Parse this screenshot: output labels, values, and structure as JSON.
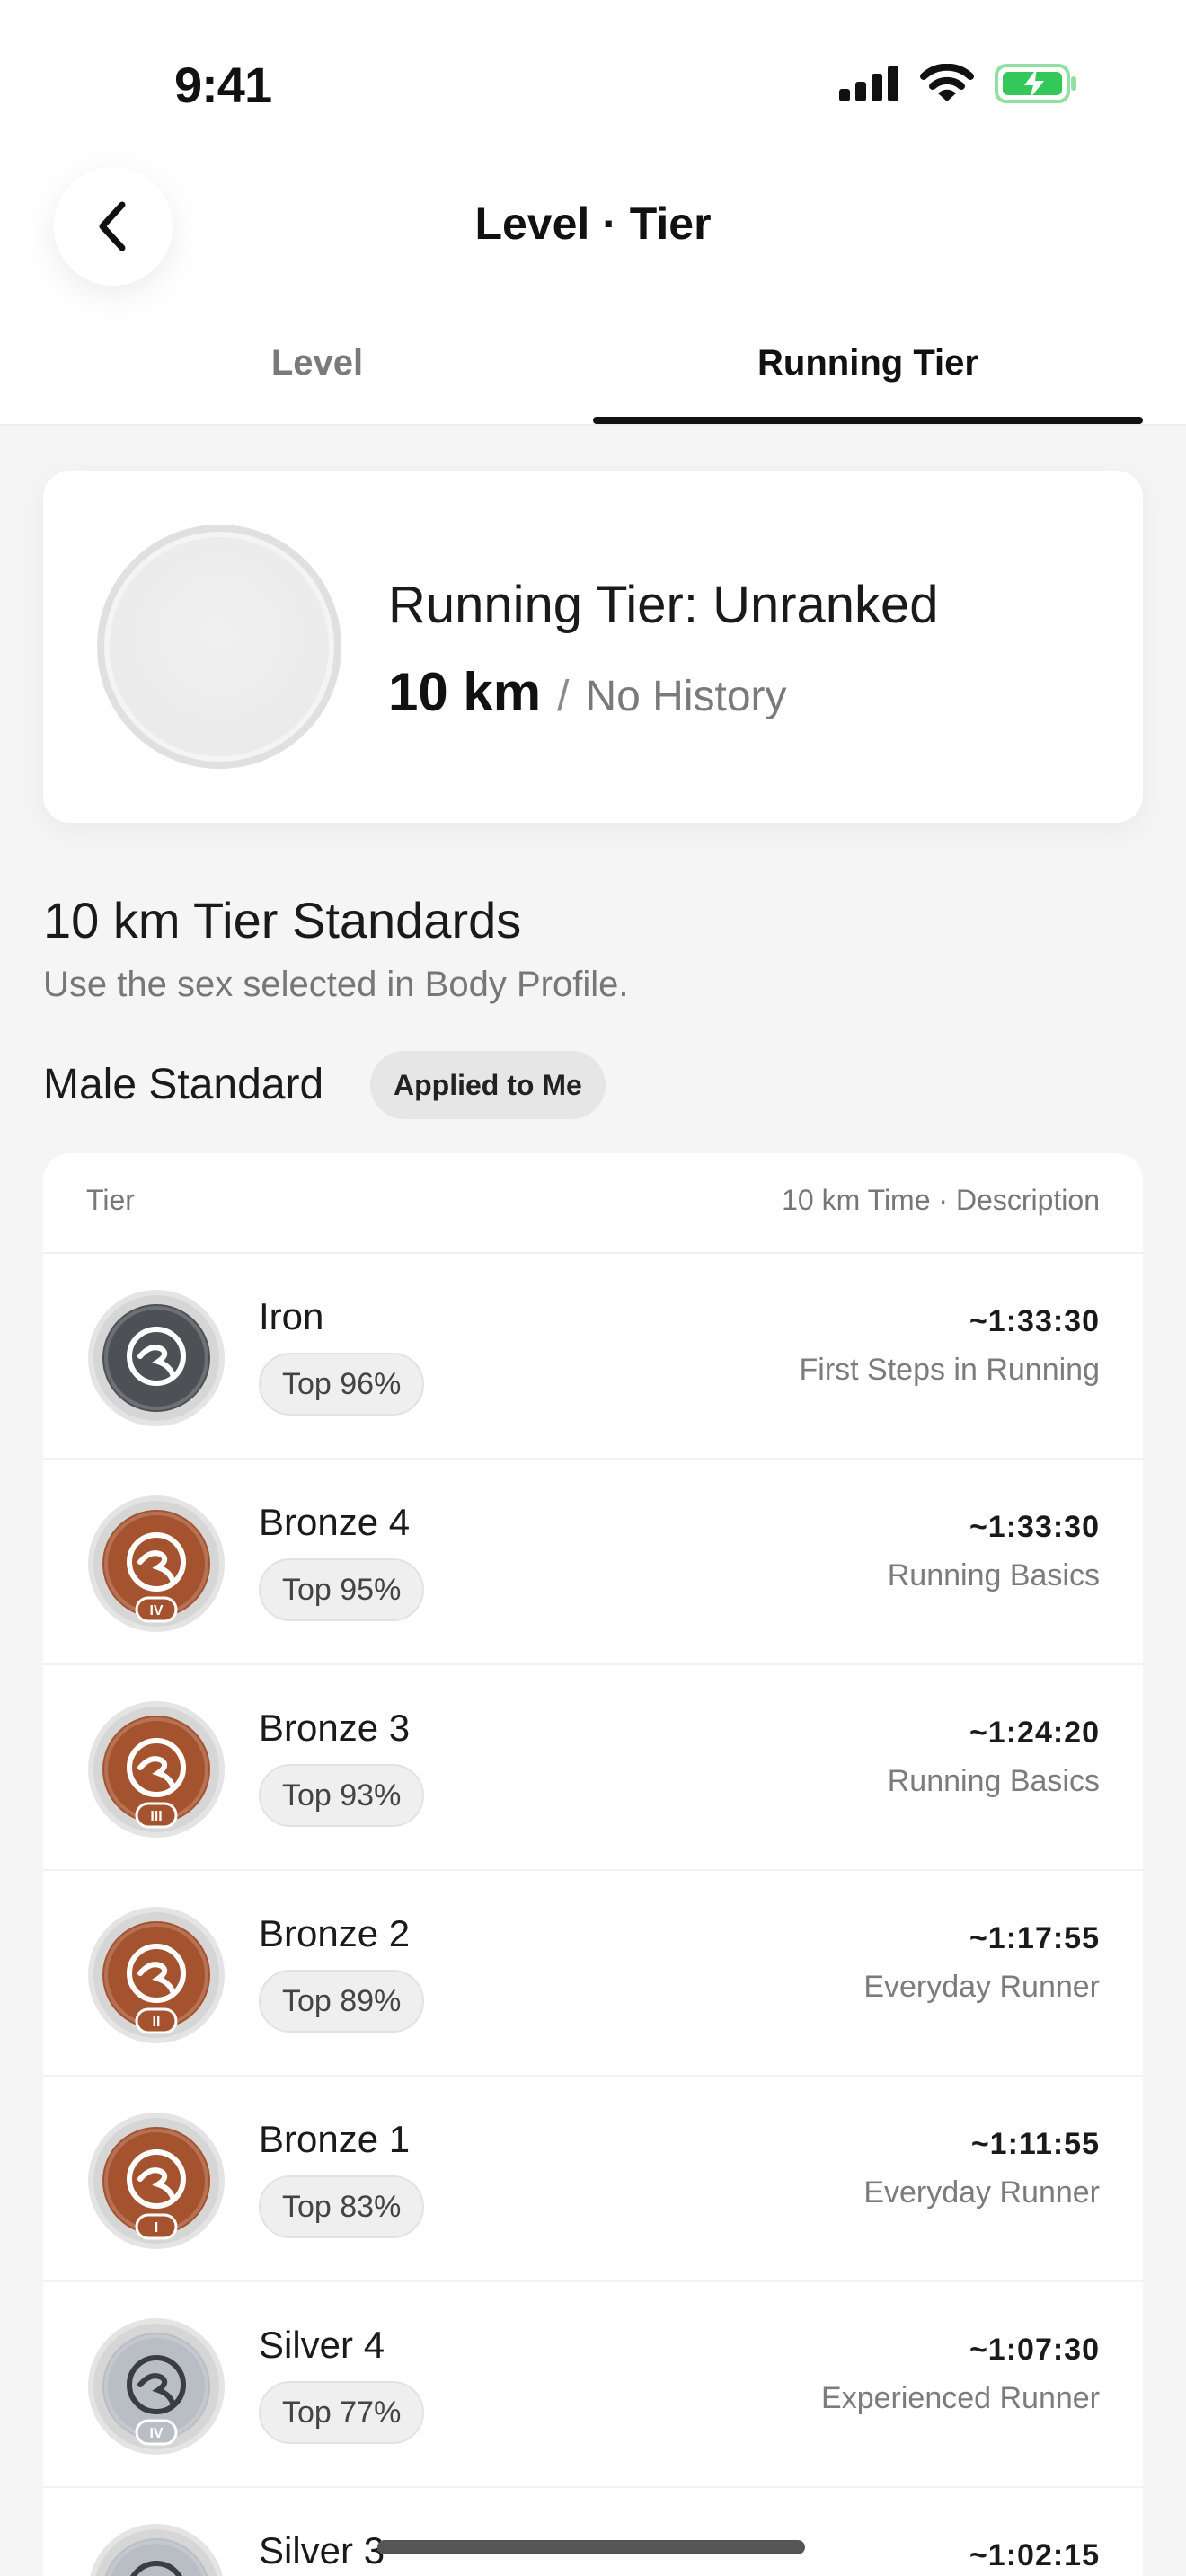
{
  "status_bar": {
    "time": "9:41"
  },
  "header": {
    "title": "Level · Tier"
  },
  "tabs": [
    {
      "label": "Level",
      "active": false
    },
    {
      "label": "Running Tier",
      "active": true
    }
  ],
  "summary": {
    "title": "Running Tier: Unranked",
    "distance": "10 km",
    "separator": "/",
    "history": "No History"
  },
  "standards": {
    "heading": "10 km Tier Standards",
    "subtitle": "Use the sex selected in Body Profile.",
    "group_label": "Male Standard",
    "applied_chip": "Applied to Me",
    "table_header_left": "Tier",
    "table_header_right": "10 km Time · Description",
    "rows": [
      {
        "name": "Iron",
        "top": "Top 96%",
        "time": "~1:33:30",
        "desc": "First Steps in Running",
        "badge": "iron",
        "numeral": ""
      },
      {
        "name": "Bronze 4",
        "top": "Top 95%",
        "time": "~1:33:30",
        "desc": "Running Basics",
        "badge": "bronze",
        "numeral": "IV"
      },
      {
        "name": "Bronze 3",
        "top": "Top 93%",
        "time": "~1:24:20",
        "desc": "Running Basics",
        "badge": "bronze",
        "numeral": "III"
      },
      {
        "name": "Bronze 2",
        "top": "Top 89%",
        "time": "~1:17:55",
        "desc": "Everyday Runner",
        "badge": "bronze",
        "numeral": "II"
      },
      {
        "name": "Bronze 1",
        "top": "Top 83%",
        "time": "~1:11:55",
        "desc": "Everyday Runner",
        "badge": "bronze",
        "numeral": "I"
      },
      {
        "name": "Silver 4",
        "top": "Top 77%",
        "time": "~1:07:30",
        "desc": "Experienced Runner",
        "badge": "silver",
        "numeral": "IV"
      },
      {
        "name": "Silver 3",
        "top": "",
        "time": "~1:02:15",
        "desc": "",
        "badge": "silver",
        "numeral": ""
      }
    ]
  },
  "colors": {
    "iron": "#4d5156",
    "bronze": "#a5532f",
    "silver": "#b9bec5",
    "battery": "#34c759"
  }
}
